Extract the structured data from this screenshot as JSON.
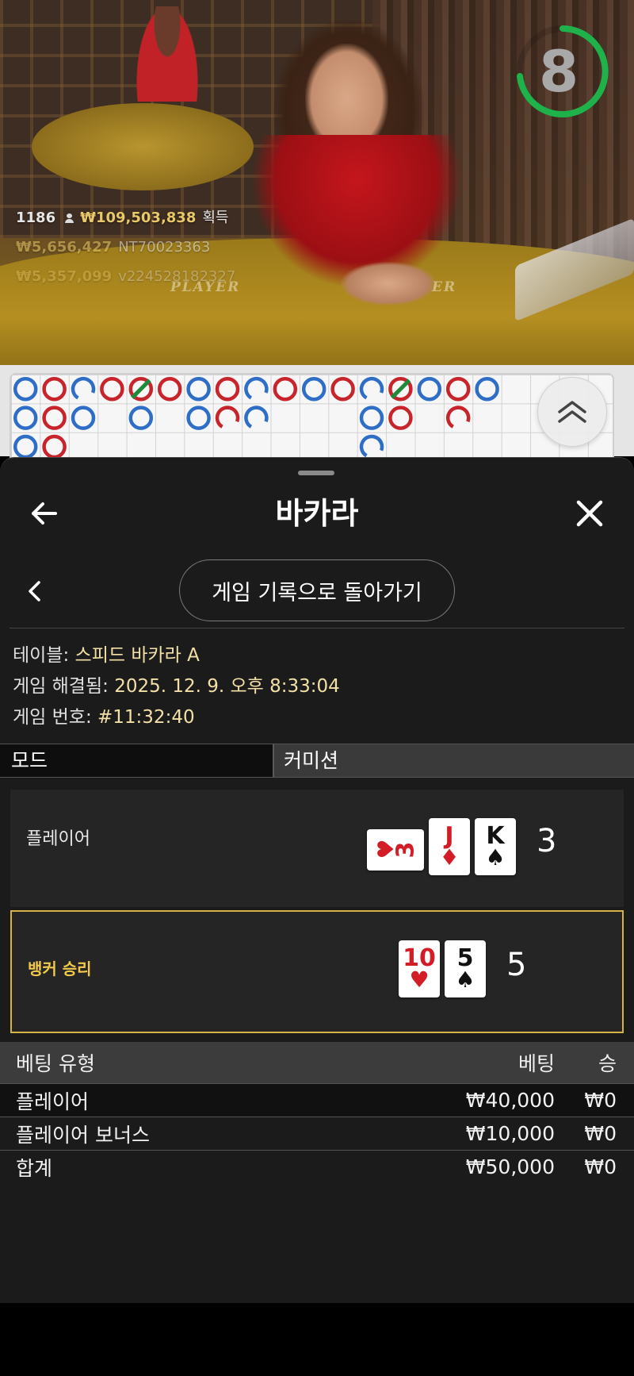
{
  "video": {
    "timer": "8",
    "table_word_left": "PLAYER",
    "table_word_right": "ER",
    "stats": {
      "players": "1186",
      "total_payout": "₩109,503,838",
      "payout_suffix": "획득",
      "recent_win_1": "₩5,656,427",
      "recent_user_1": "NT70023363",
      "recent_win_2": "₩5,357,099",
      "recent_user_2": "v224528182327"
    }
  },
  "roadmap": {
    "columns": [
      [
        "P",
        "P",
        "P"
      ],
      [
        "B",
        "B",
        "B"
      ],
      [
        "Pc",
        "P"
      ],
      [
        "B"
      ],
      [
        "Bt",
        "P"
      ],
      [
        "B"
      ],
      [
        "P",
        "P"
      ],
      [
        "B",
        "Bc"
      ],
      [
        "Pc",
        "Pc"
      ],
      [
        "B"
      ],
      [
        "P"
      ],
      [
        "B"
      ],
      [
        "Pc",
        "P",
        "Pc"
      ],
      [
        "Bt",
        "B"
      ],
      [
        "P"
      ],
      [
        "B",
        "Bc"
      ],
      [
        "P"
      ]
    ]
  },
  "sheet": {
    "title": "바카라",
    "back_to_history": "게임 기록으로 돌아가기",
    "info": {
      "table_label": "테이블:",
      "table_value": "스피드 바카라 A",
      "resolved_label": "게임 해결됨:",
      "resolved_value": "2025. 12. 9. 오후 8:33:04",
      "number_label": "게임 번호:",
      "number_value": "#11:32:40"
    },
    "mode_label": "모드",
    "mode_value": "커미션",
    "player_hand": {
      "label": "플레이어",
      "total": "3",
      "cards": [
        {
          "rank": "3",
          "suit": "♥",
          "color": "#d31c25",
          "rotated": true
        },
        {
          "rank": "J",
          "suit": "♦",
          "color": "#d31c25",
          "rotated": false
        },
        {
          "rank": "K",
          "suit": "♠",
          "color": "#111111",
          "rotated": false
        }
      ]
    },
    "banker_hand": {
      "label": "뱅커 승리",
      "total": "5",
      "cards": [
        {
          "rank": "10",
          "suit": "♥",
          "color": "#d31c25",
          "rotated": false
        },
        {
          "rank": "5",
          "suit": "♠",
          "color": "#111111",
          "rotated": false
        }
      ]
    },
    "bets": {
      "headers": {
        "type": "베팅 유형",
        "bet": "베팅",
        "win": "승"
      },
      "rows": [
        {
          "type": "플레이어",
          "bet": "₩40,000",
          "win": "₩0"
        },
        {
          "type": "플레이어 보너스",
          "bet": "₩10,000",
          "win": "₩0"
        },
        {
          "type": "합계",
          "bet": "₩50,000",
          "win": "₩0"
        }
      ]
    }
  },
  "colors": {
    "player_blue": "#2f6ec7",
    "banker_red": "#c8242b",
    "tie_green": "#1e8a3a",
    "timer_green": "#1fb24a",
    "winner_border": "#d6b347"
  }
}
